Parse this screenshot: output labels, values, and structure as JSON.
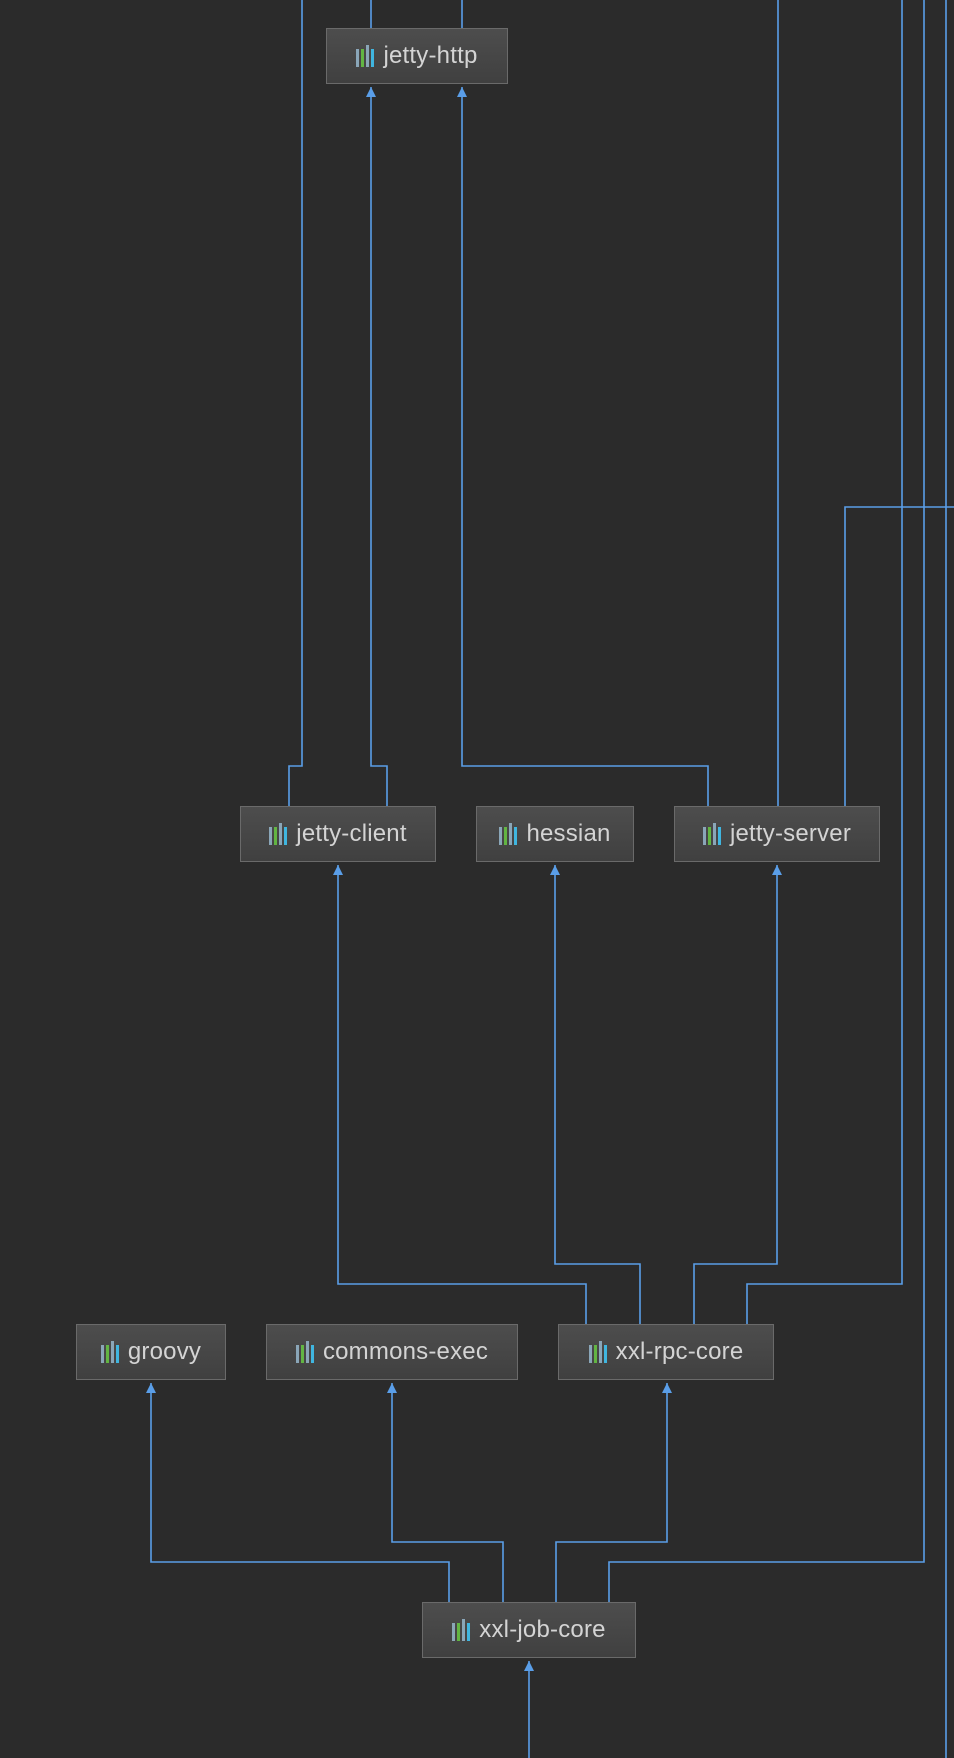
{
  "colors": {
    "background": "#2b2b2b",
    "edge": "#5a9ee8",
    "node_fill": "#454545",
    "node_border": "#6a6a6a",
    "node_text": "#d4d4d4"
  },
  "nodes": [
    {
      "id": "jetty-http",
      "label": "jetty-http",
      "icon": "library-icon"
    },
    {
      "id": "jetty-client",
      "label": "jetty-client",
      "icon": "library-icon"
    },
    {
      "id": "hessian",
      "label": "hessian",
      "icon": "library-icon"
    },
    {
      "id": "jetty-server",
      "label": "jetty-server",
      "icon": "library-icon"
    },
    {
      "id": "groovy",
      "label": "groovy",
      "icon": "library-icon"
    },
    {
      "id": "commons-exec",
      "label": "commons-exec",
      "icon": "library-icon"
    },
    {
      "id": "xxl-rpc-core",
      "label": "xxl-rpc-core",
      "icon": "library-icon"
    },
    {
      "id": "xxl-job-core",
      "label": "xxl-job-core",
      "icon": "library-icon"
    }
  ],
  "edges": [
    {
      "from": "jetty-client",
      "to": "jetty-http"
    },
    {
      "from": "jetty-server",
      "to": "jetty-http"
    },
    {
      "from": "xxl-rpc-core",
      "to": "jetty-client"
    },
    {
      "from": "xxl-rpc-core",
      "to": "hessian"
    },
    {
      "from": "xxl-rpc-core",
      "to": "jetty-server"
    },
    {
      "from": "xxl-job-core",
      "to": "groovy"
    },
    {
      "from": "xxl-job-core",
      "to": "commons-exec"
    },
    {
      "from": "xxl-job-core",
      "to": "xxl-rpc-core"
    }
  ]
}
